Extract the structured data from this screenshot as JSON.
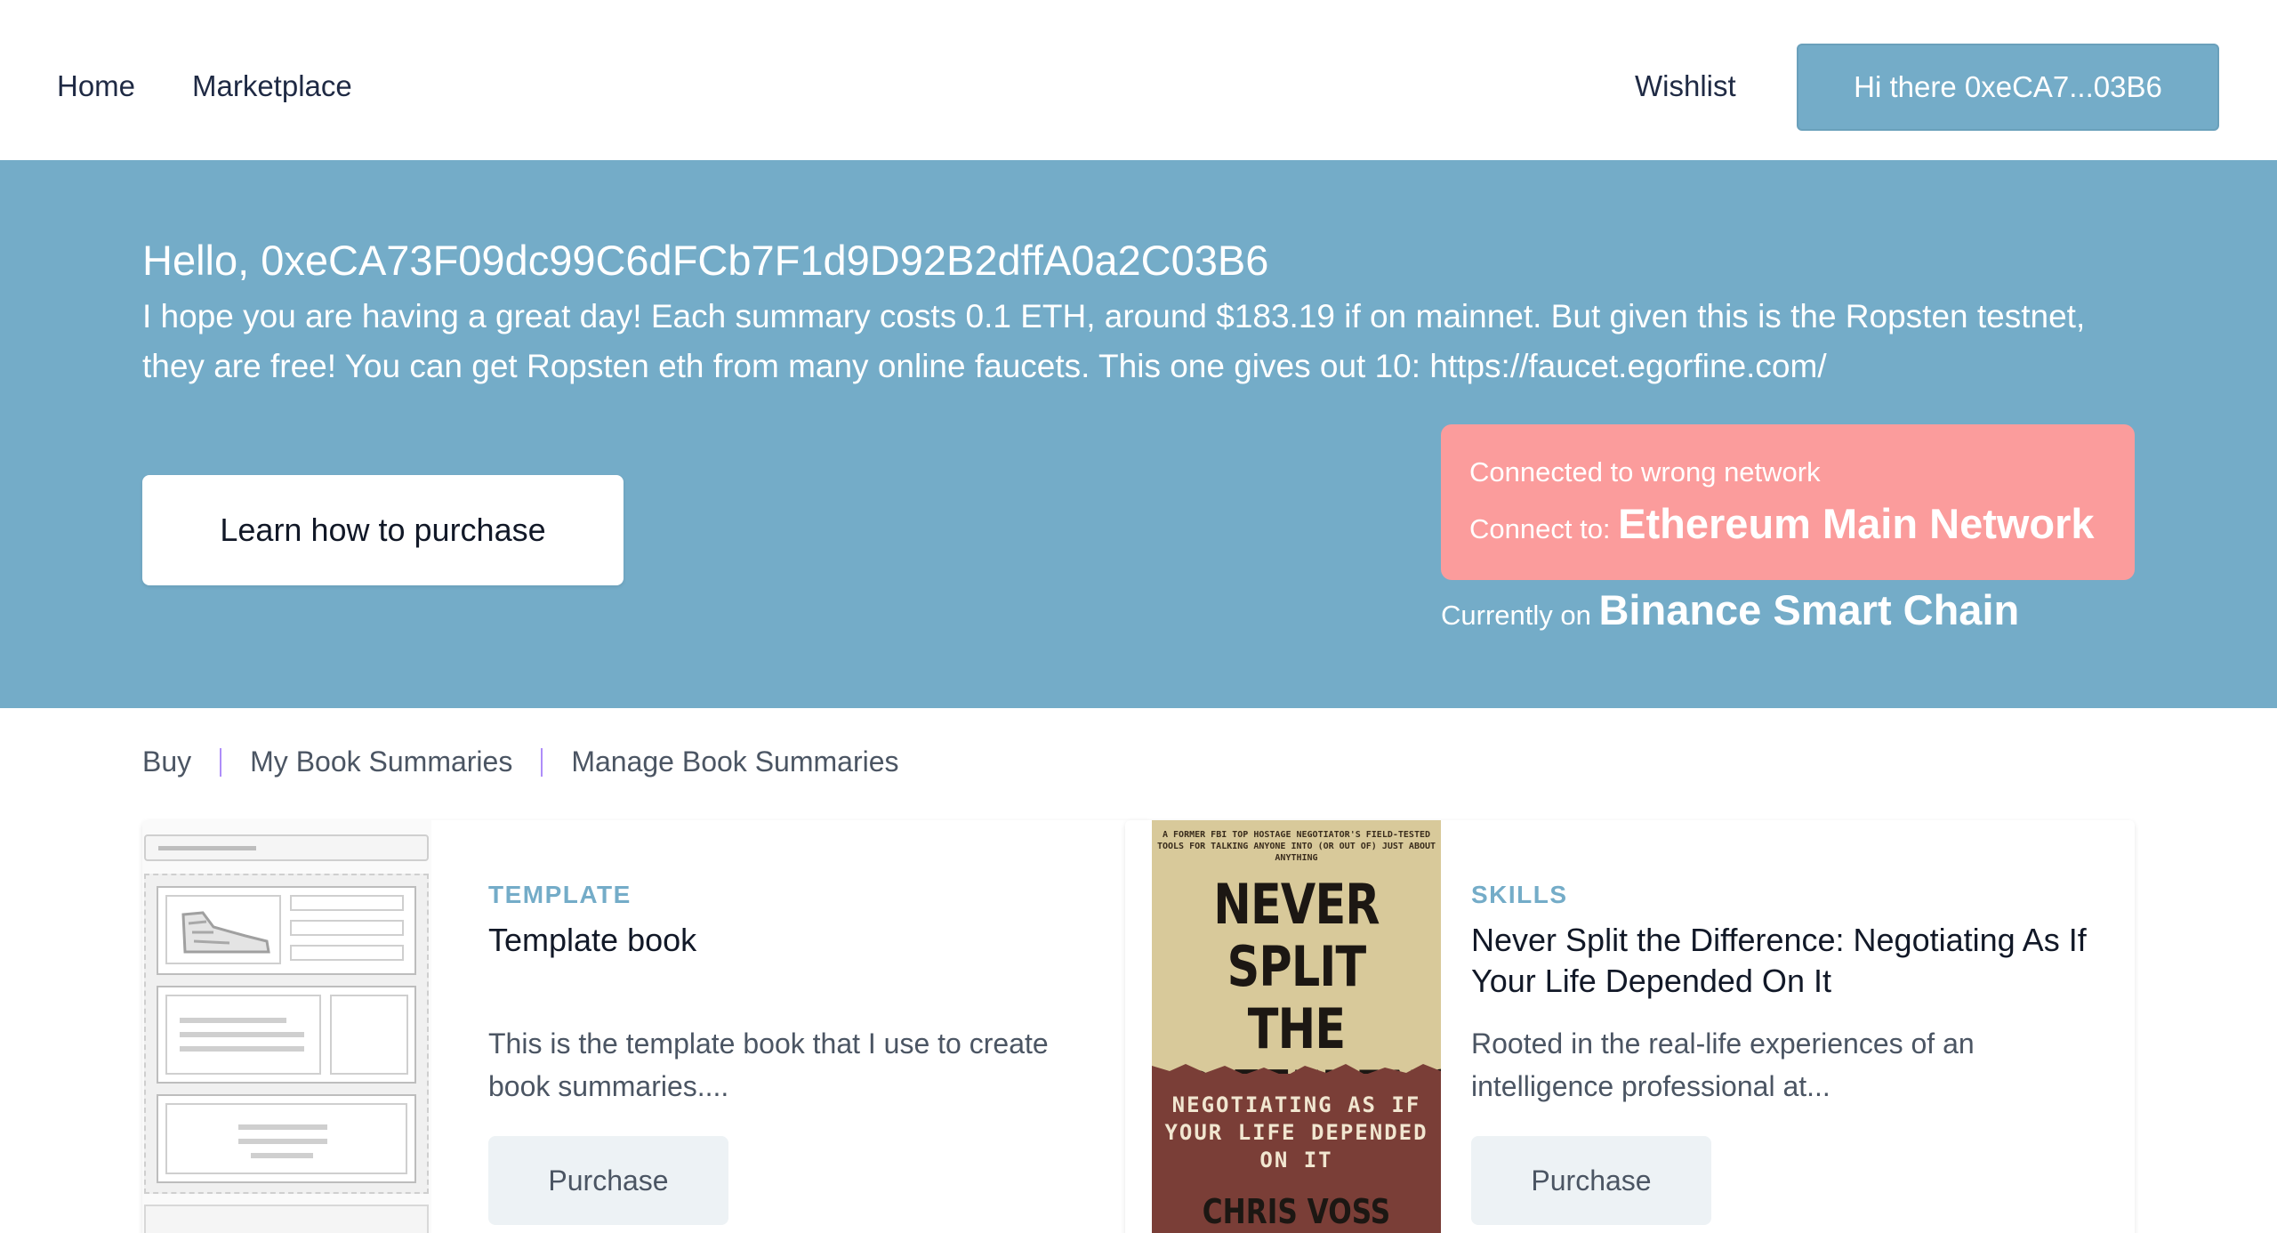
{
  "nav": {
    "home": "Home",
    "marketplace": "Marketplace",
    "wishlist": "Wishlist",
    "account_button": "Hi there 0xeCA7...03B6"
  },
  "hero": {
    "greeting": "Hello, 0xeCA73F09dc99C6dFCb7F1d9D92B2dffA0a2C03B6",
    "message": "I hope you are having a great day! Each summary costs 0.1 ETH, around $183.19 if on mainnet. But given this is the Ropsten testnet, they are free! You can get Ropsten eth from many online faucets. This one gives out 10: https://faucet.egorfine.com/",
    "learn_button": "Learn how to purchase",
    "network_warning": {
      "title": "Connected to wrong network",
      "connect_prefix": "Connect to:",
      "target_network": "Ethereum Main Network",
      "current_prefix": "Currently on",
      "current_network": "Binance Smart Chain"
    }
  },
  "tabs": [
    "Buy",
    "My Book Summaries",
    "Manage Book Summaries"
  ],
  "cards": [
    {
      "category": "TEMPLATE",
      "title": "Template book",
      "description": "This is the template book that I use to create book summaries....",
      "button": "Purchase"
    },
    {
      "category": "SKILLS",
      "title": "Never Split the Difference: Negotiating As If Your Life Depended On It",
      "description": "Rooted in the real-life experiences of an intelligence professional at...",
      "button": "Purchase",
      "cover": {
        "top_text": "A FORMER FBI TOP HOSTAGE NEGOTIATOR'S FIELD-TESTED TOOLS FOR TALKING ANYONE INTO (OR OUT OF) JUST ABOUT ANYTHING",
        "title": "NEVER SPLIT THE DIFFERENCE",
        "subtitle": "NEGOTIATING AS IF YOUR LIFE DEPENDED ON IT",
        "author": "CHRIS VOSS"
      }
    }
  ],
  "colors": {
    "accent": "#74acc8",
    "warning": "#fb9c9c",
    "button_muted": "#edf2f5"
  }
}
